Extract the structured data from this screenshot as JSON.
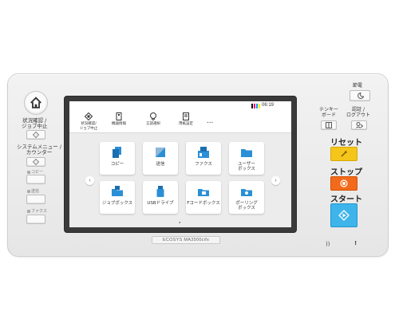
{
  "left": {
    "home_icon": "home-icon",
    "status_label": "状況確認 /\nジョブ中止",
    "system_label": "システムメニュー /\nカウンター",
    "copy_tag": "コピー",
    "send_tag": "送信",
    "fax_tag": "ファクス"
  },
  "screen": {
    "clock": "06:19",
    "toner_colors": [
      "#111111",
      "#e4007f",
      "#00a0e9",
      "#fff100"
    ],
    "functions": [
      {
        "label": "状況確認/\nジョブ中止",
        "icon": "status-icon"
      },
      {
        "label": "機器情報",
        "icon": "device-info-icon"
      },
      {
        "label": "言語選択",
        "icon": "language-icon"
      },
      {
        "label": "用紙設定",
        "icon": "paper-settings-icon"
      }
    ],
    "more": "...",
    "tiles": [
      {
        "label": "コピー",
        "icon": "copy-icon"
      },
      {
        "label": "送信",
        "icon": "send-icon"
      },
      {
        "label": "ファクス",
        "icon": "fax-icon"
      },
      {
        "label": "ユーザー\nボックス",
        "icon": "user-box-icon"
      },
      {
        "label": "ジョブボックス",
        "icon": "job-box-icon"
      },
      {
        "label": "USBドライブ",
        "icon": "usb-icon"
      },
      {
        "label": "Fコードボックス",
        "icon": "fcode-box-icon"
      },
      {
        "label": "ポーリング\nボックス",
        "icon": "polling-box-icon"
      }
    ],
    "prev_arrow": "‹",
    "next_arrow": "›",
    "page_indicator": "●"
  },
  "model": "ECOSYS MA3500cifx",
  "right": {
    "power_save_label": "節電",
    "tenkey_label": "テンキー\nボード",
    "auth_label": "認証 /\nログアウト",
    "reset_label": "リセット",
    "stop_label": "ストップ",
    "start_label": "スタート",
    "indicator_nfc": "))",
    "indicator_alert": "!"
  },
  "colors": {
    "reset": "#f5c51b",
    "stop": "#f26a1b",
    "start": "#3db4ea",
    "folder": "#2a8fd6"
  }
}
